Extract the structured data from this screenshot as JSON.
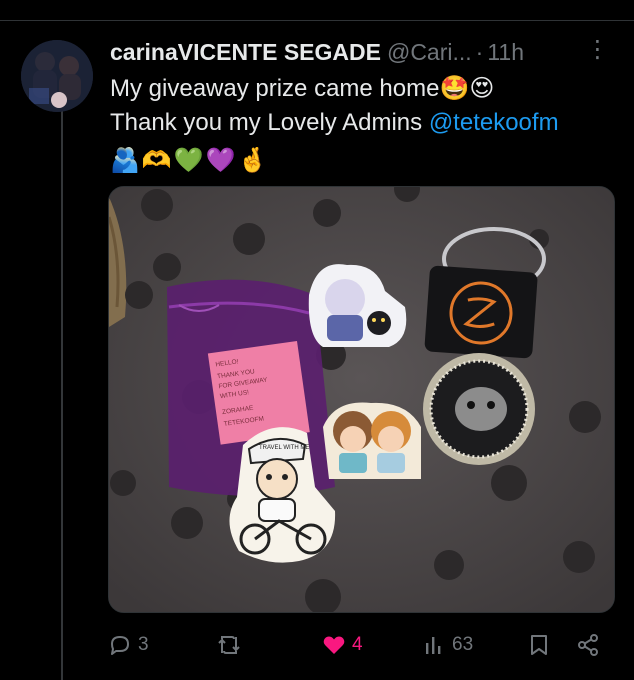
{
  "post": {
    "author_name": "carinaVICENTE SEGADE",
    "author_handle": "@Cari...",
    "separator": "·",
    "time": "11h",
    "more_label": "⋮",
    "line1": "My giveaway prize came home",
    "line1_emojis": "🤩😍",
    "line2_prefix": "Thank you my Lovely Admins ",
    "mention": "@tetekoofm",
    "emojis": [
      "🫂",
      "🫶",
      "💚",
      "💜",
      "🤞"
    ]
  },
  "photo": {
    "note_lines": [
      "HELLO!",
      "THANK YOU",
      "FOR GIVEAWAY",
      "WITH US!",
      "ZORAHAE",
      "TETEKOOFM"
    ],
    "sticker_text": "TRAVEL WITH ME"
  },
  "actions": {
    "replies": "3",
    "reposts": "",
    "likes": "4",
    "views": "63"
  },
  "colors": {
    "accent": "#1d9bf0",
    "like": "#f91880",
    "muted": "#71767b",
    "background": "#000000"
  }
}
